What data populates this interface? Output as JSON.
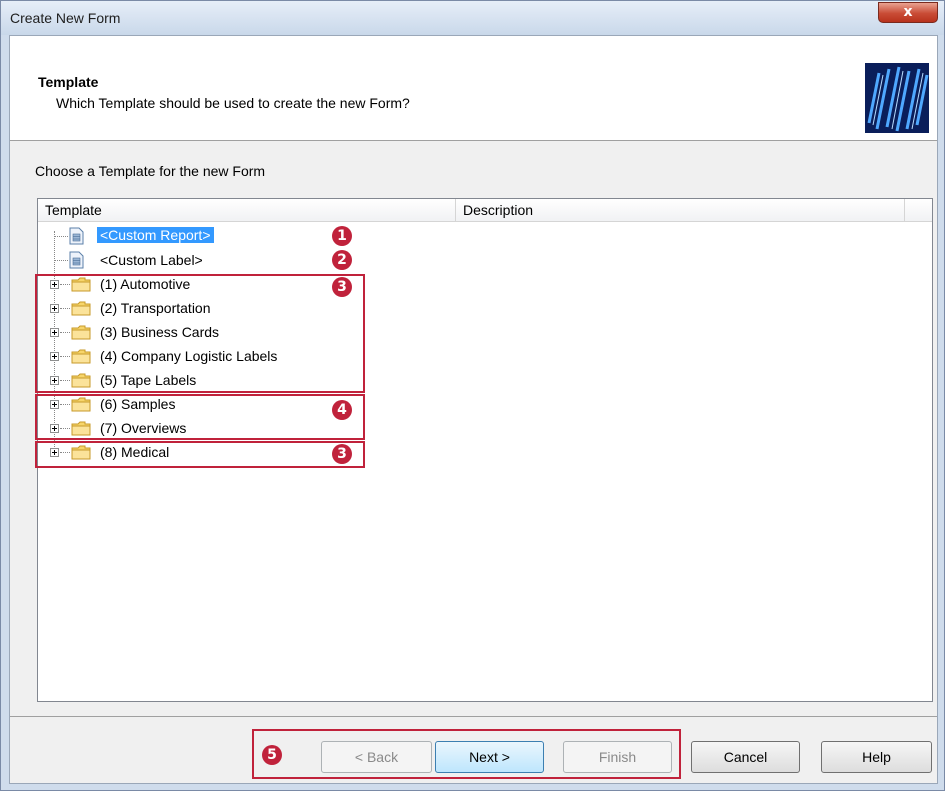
{
  "window": {
    "title": "Create New Form",
    "close_glyph": "x"
  },
  "header": {
    "title": "Template",
    "subtitle": "Which Template should be used to create the new Form?"
  },
  "section_label": "Choose a Template for the new Form",
  "list": {
    "columns": [
      "Template",
      "Description"
    ],
    "items": [
      {
        "label": "<Custom Report>",
        "icon": "document-icon",
        "selected": true
      },
      {
        "label": "<Custom Label>",
        "icon": "document-icon",
        "selected": false
      },
      {
        "label": "(1) Automotive",
        "icon": "folder-icon",
        "expandable": true
      },
      {
        "label": "(2) Transportation",
        "icon": "folder-icon",
        "expandable": true
      },
      {
        "label": "(3) Business Cards",
        "icon": "folder-icon",
        "expandable": true
      },
      {
        "label": "(4) Company Logistic Labels",
        "icon": "folder-icon",
        "expandable": true
      },
      {
        "label": "(5) Tape Labels",
        "icon": "folder-icon",
        "expandable": true
      },
      {
        "label": "(6) Samples",
        "icon": "folder-icon",
        "expandable": true
      },
      {
        "label": "(7) Overviews",
        "icon": "folder-icon",
        "expandable": true
      },
      {
        "label": "(8) Medical",
        "icon": "folder-icon",
        "expandable": true
      }
    ]
  },
  "annotations": [
    "1",
    "2",
    "3",
    "4",
    "3",
    "5"
  ],
  "buttons": {
    "back": "< Back",
    "next": "Next >",
    "finish": "Finish",
    "cancel": "Cancel",
    "help": "Help"
  },
  "colors": {
    "annotation": "#c0223b",
    "selection": "#3399ff"
  }
}
